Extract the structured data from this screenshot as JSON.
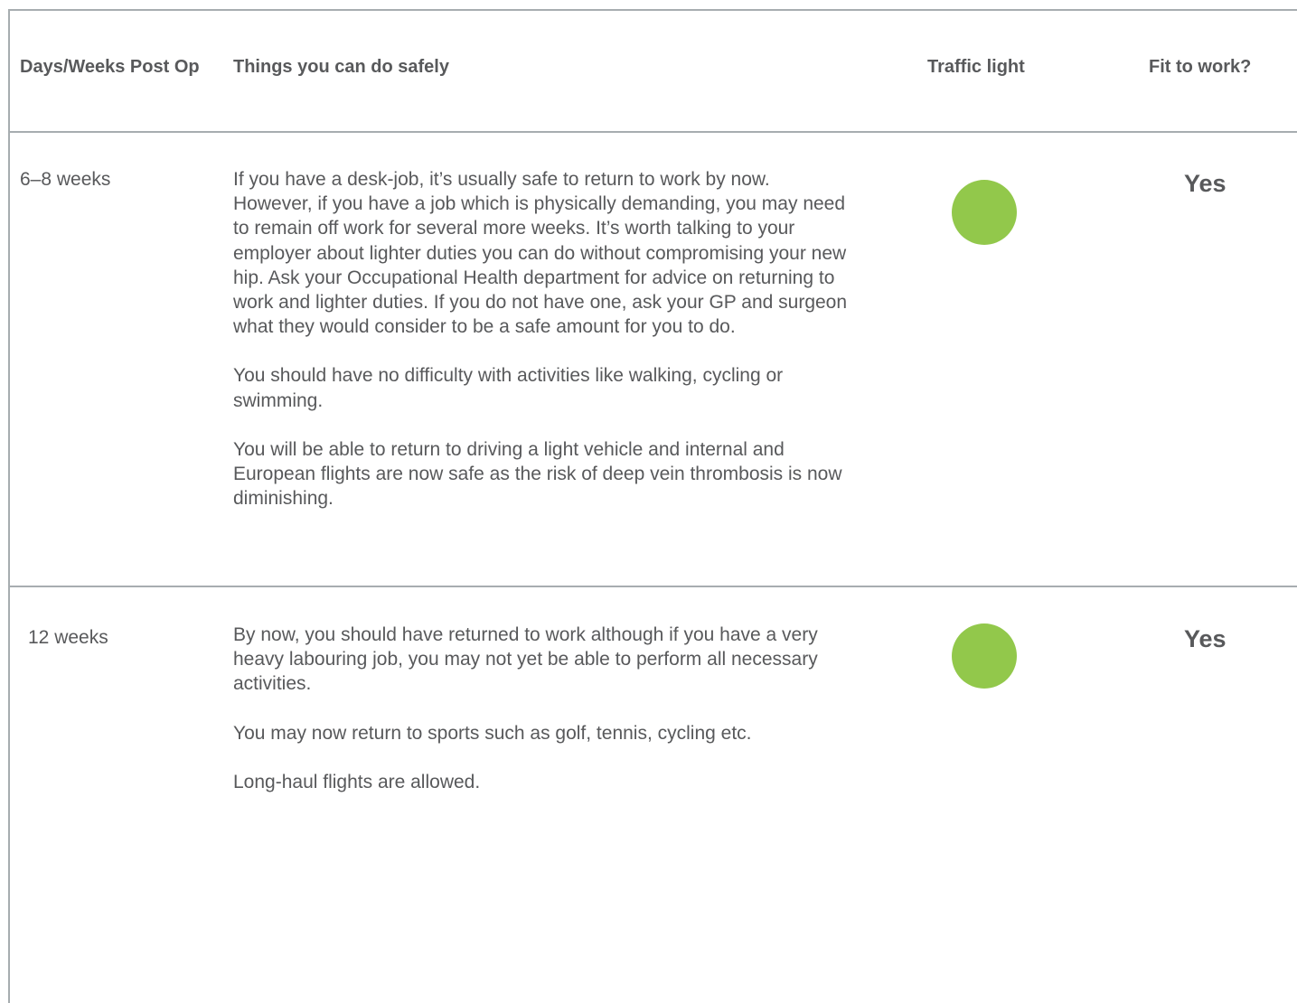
{
  "header": {
    "days_weeks": "Days/Weeks Post Op",
    "things": "Things you can do safely",
    "traffic": "Traffic light",
    "fit": "Fit to work?"
  },
  "rows": [
    {
      "period": "6–8 weeks",
      "paragraphs": [
        "If you have a desk-job, it’s usually safe to return to work by now. However, if you have a job which is physically demanding, you may need to remain off work for several more weeks. It’s worth talking to your employer about lighter duties you can do without compromising your new hip. Ask your Occupational Health department for advice on returning to work and lighter duties. If you do not have one, ask your GP and surgeon what they would consider to be a safe amount for you to do.",
        "You should have no difficulty with activities like walking, cycling or swimming.",
        "You will be able to return to driving a light vehicle and internal and European flights are now safe as the risk of deep vein thrombosis is now diminishing."
      ],
      "traffic_color": "#92c84b",
      "fit": "Yes"
    },
    {
      "period": "12 weeks",
      "paragraphs": [
        "By now, you should have returned to work although if you have a very heavy labouring job, you may not yet be able to perform all necessary activities.",
        "You may now return to sports such as golf, tennis, cycling etc.",
        "Long-haul flights are allowed."
      ],
      "traffic_color": "#92c84b",
      "fit": "Yes"
    }
  ]
}
